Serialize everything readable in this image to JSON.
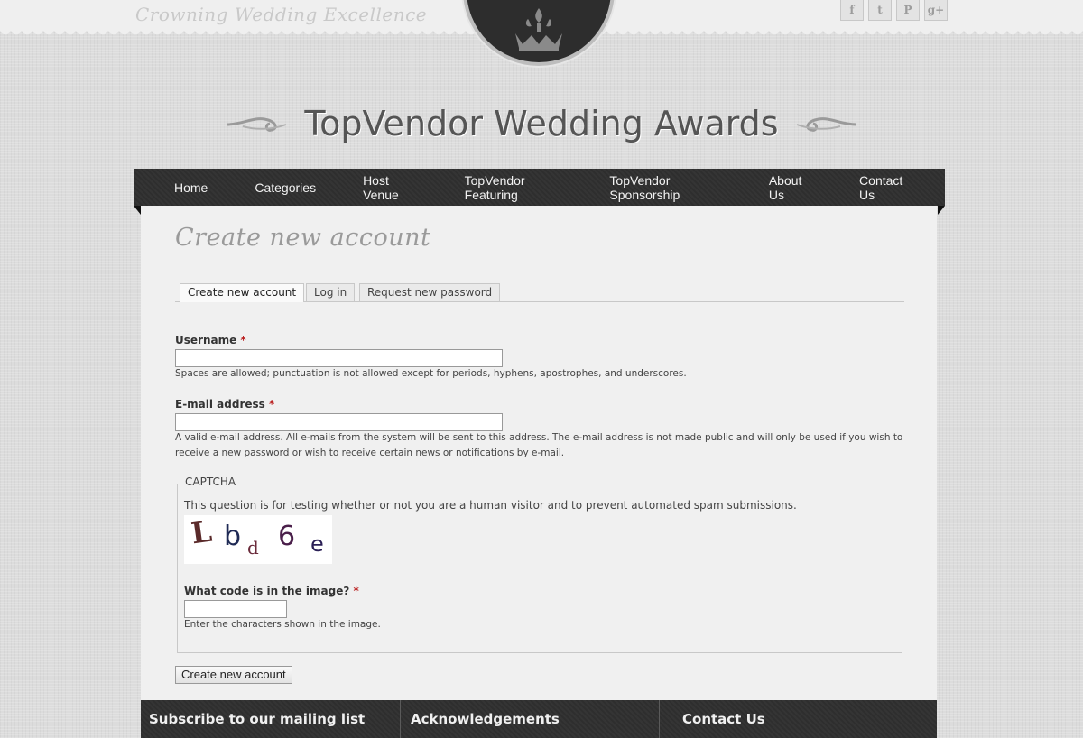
{
  "header": {
    "tagline": "Crowning Wedding Excellence",
    "site_title": "TopVendor Wedding Awards",
    "social": [
      {
        "icon": "facebook-icon",
        "glyph": "f"
      },
      {
        "icon": "twitter-icon",
        "glyph": "t"
      },
      {
        "icon": "pinterest-icon",
        "glyph": "P"
      },
      {
        "icon": "google-plus-icon",
        "glyph": "g+"
      }
    ]
  },
  "nav": {
    "items": [
      "Home",
      "Categories",
      "Host Venue",
      "TopVendor Featuring",
      "TopVendor Sponsorship",
      "About Us",
      "Contact Us"
    ]
  },
  "page": {
    "title": "Create new account",
    "tabs": [
      "Create new account",
      "Log in",
      "Request new password"
    ]
  },
  "form": {
    "username_label": "Username",
    "required_mark": "*",
    "username_value": "",
    "username_desc": "Spaces are allowed; punctuation is not allowed except for periods, hyphens, apostrophes, and underscores.",
    "email_label": "E-mail address",
    "email_value": "",
    "email_desc_line1": "A valid e-mail address. All e-mails from the system will be sent to this address. The e-mail address is not made public and will only be used if you wish to",
    "email_desc_line2": "receive a new password or wish to receive certain news or notifications by e-mail.",
    "captcha_legend": "CAPTCHA",
    "captcha_intro": "This question is for testing whether or not you are a human visitor and to prevent automated spam submissions.",
    "captcha_chars": [
      "L",
      "b",
      "d",
      "6",
      "e"
    ],
    "captcha_label": "What code is in the image?",
    "captcha_value": "",
    "captcha_desc": "Enter the characters shown in the image.",
    "submit_label": "Create new account"
  },
  "footer": {
    "columns": [
      "Subscribe to our mailing list",
      "Acknowledgements",
      "Contact Us"
    ]
  },
  "colors": {
    "nav_bg": "#2e2e2e",
    "required": "#bb2222"
  }
}
